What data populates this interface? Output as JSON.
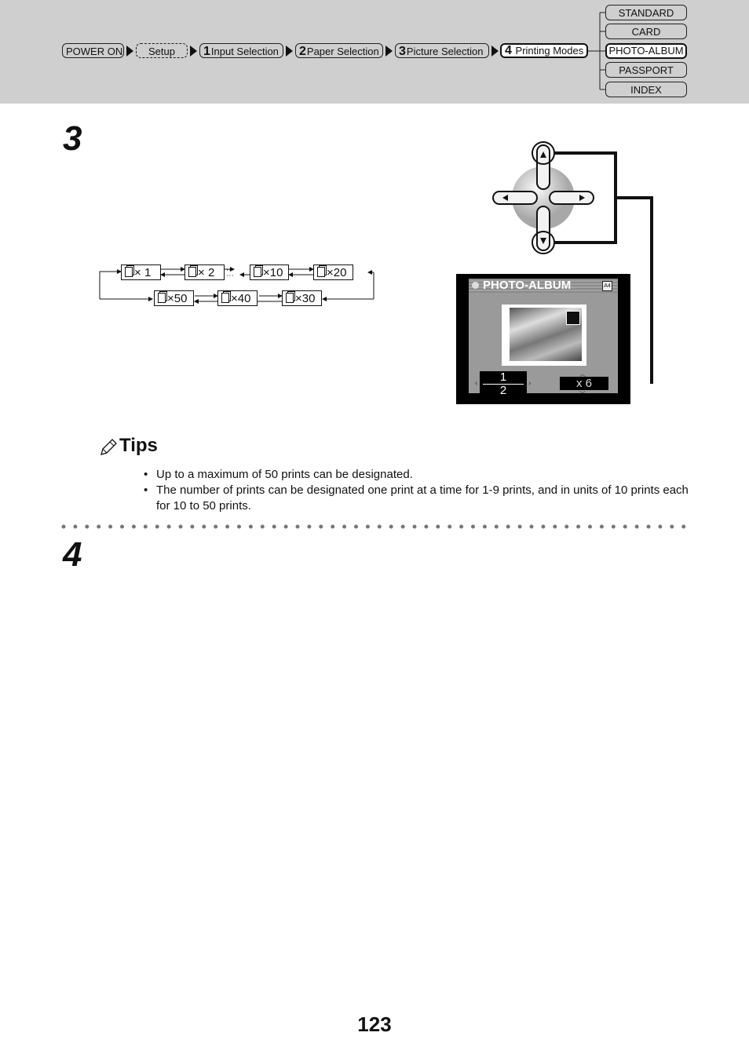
{
  "header": {
    "breadcrumb": [
      {
        "label": "POWER ON",
        "num": ""
      },
      {
        "label": "Setup",
        "num": ""
      },
      {
        "label": "Input Selection",
        "num": "1"
      },
      {
        "label": "Paper Selection",
        "num": "2"
      },
      {
        "label": "Picture Selection",
        "num": "3"
      },
      {
        "label": "Printing Modes",
        "num": "4"
      }
    ],
    "modes": [
      "STANDARD",
      "CARD",
      "PHOTO-ALBUM",
      "PASSPORT",
      "INDEX"
    ],
    "active_mode": "PHOTO-ALBUM"
  },
  "steps": {
    "step3": "3",
    "step4": "4"
  },
  "copies_cycle": {
    "prefix": "×",
    "row1": [
      "1",
      "2",
      "10",
      "20"
    ],
    "row2": [
      "50",
      "40",
      "30"
    ],
    "ellipsis": "⋯"
  },
  "lcd": {
    "title": "PHOTO-ALBUM",
    "page_current": "1",
    "page_total": "2",
    "copies": "x 6",
    "paper_icon": "A4"
  },
  "tips": {
    "title": "Tips",
    "items": [
      "Up to a maximum of 50 prints can be designated.",
      "The number of prints can be designated one print at a time for 1-9 prints, and in units of 10 prints each for 10 to 50 prints."
    ]
  },
  "page_number": "123"
}
